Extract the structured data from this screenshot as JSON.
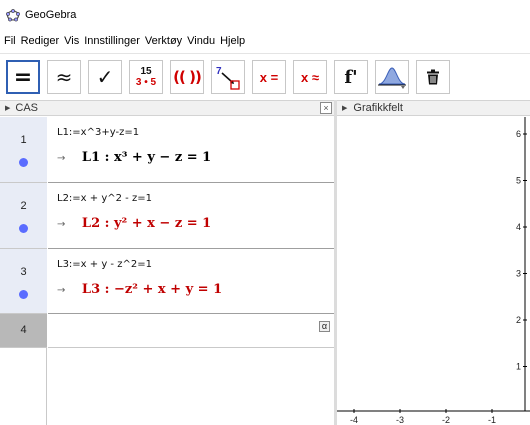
{
  "window": {
    "title": "GeoGebra"
  },
  "menu": [
    "Fil",
    "Rediger",
    "Vis",
    "Innstillinger",
    "Verktøy",
    "Vindu",
    "Hjelp"
  ],
  "toolbar": {
    "tools": [
      {
        "name": "evaluate",
        "glyph": "="
      },
      {
        "name": "numeric",
        "glyph": "≈"
      },
      {
        "name": "keep-input",
        "glyph": "✓"
      },
      {
        "name": "factor",
        "glyph_top": "15",
        "glyph_bottom": "3 • 5"
      },
      {
        "name": "expand",
        "glyph": "(( ))"
      },
      {
        "name": "substitute",
        "glyph": "7"
      },
      {
        "name": "solve",
        "glyph": "x ="
      },
      {
        "name": "solve-numerically",
        "glyph": "x ≈"
      },
      {
        "name": "derivative",
        "glyph": "f'"
      },
      {
        "name": "probability",
        "glyph": ""
      },
      {
        "name": "delete",
        "glyph": ""
      }
    ]
  },
  "cas": {
    "header_label": "CAS",
    "close_glyph": "×",
    "rows": [
      {
        "number": "1",
        "input": "L1:=x^3+y-z=1",
        "arrow": "→",
        "output": "L1 : x³ + y − z = 1",
        "output_color": "#000000"
      },
      {
        "number": "2",
        "input": "L2:=x + y^2 - z=1",
        "arrow": "→",
        "output": "L2 : y² + x − z = 1",
        "output_color": "#c00000"
      },
      {
        "number": "3",
        "input": "L3:=x + y - z^2=1",
        "arrow": "→",
        "output": "L3 : −z² + x + y = 1",
        "output_color": "#c00000"
      },
      {
        "number": "4",
        "input": "",
        "alpha": "α"
      }
    ]
  },
  "graphics": {
    "header_label": "Grafikkfelt",
    "x_ticks": [
      "-4",
      "-3",
      "-2",
      "-1"
    ],
    "y_ticks": [
      "6",
      "5",
      "4",
      "3",
      "2",
      "1"
    ]
  }
}
